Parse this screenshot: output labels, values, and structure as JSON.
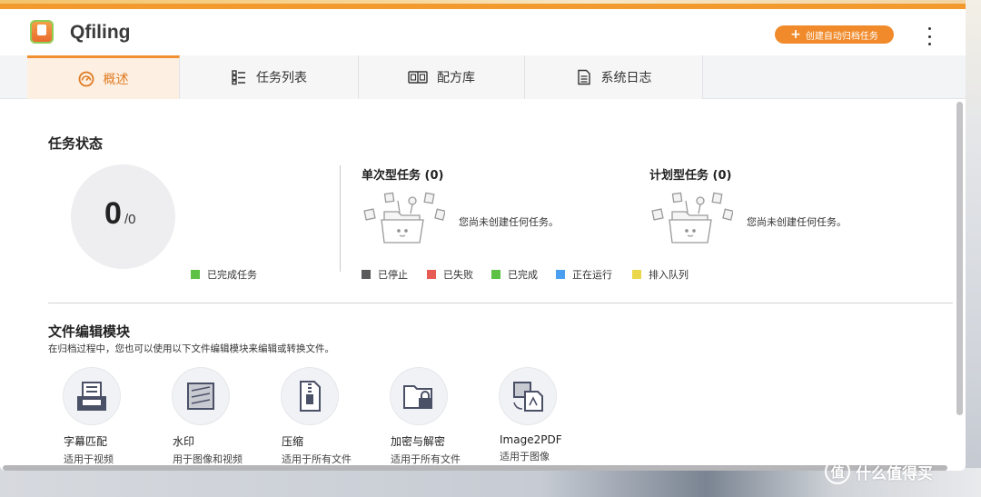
{
  "app": {
    "name": "Qfiling",
    "create_button": "创建自动归档任务",
    "accent_color": "#f08a2a"
  },
  "tabs": [
    {
      "label": "概述",
      "icon": "dashboard-icon",
      "active": true
    },
    {
      "label": "任务列表",
      "icon": "task-list-icon",
      "active": false
    },
    {
      "label": "配方库",
      "icon": "recipe-book-icon",
      "active": false
    },
    {
      "label": "系统日志",
      "icon": "log-icon",
      "active": false
    }
  ],
  "task_status": {
    "title": "任务状态",
    "completed": "0",
    "total": "/0",
    "legend_completed": "已完成任务",
    "single": {
      "title": "单次型任务 (0)",
      "empty_text": "您尚未创建任何任务。"
    },
    "scheduled": {
      "title": "计划型任务 (0)",
      "empty_text": "您尚未创建任何任务。"
    },
    "legend": [
      {
        "label": "已停止",
        "color": "#5a5a5c"
      },
      {
        "label": "已失败",
        "color": "#e85a54"
      },
      {
        "label": "已完成",
        "color": "#5cc145"
      },
      {
        "label": "正在运行",
        "color": "#4a9ff0"
      },
      {
        "label": "排入队列",
        "color": "#ead84a"
      }
    ]
  },
  "modules": {
    "title": "文件编辑模块",
    "description": "在归档过程中，您也可以使用以下文件编辑模块来编辑或转换文件。",
    "items": [
      {
        "name": "字幕匹配",
        "desc": "适用于视频",
        "icon": "subtitle-icon"
      },
      {
        "name": "水印",
        "desc": "用于图像和视频",
        "icon": "watermark-icon"
      },
      {
        "name": "压缩",
        "desc": "适用于所有文件",
        "icon": "compress-icon"
      },
      {
        "name": "加密与解密",
        "desc": "适用于所有文件",
        "icon": "encrypt-icon"
      },
      {
        "name": "Image2PDF",
        "desc": "适用于图像",
        "icon": "image2pdf-icon"
      }
    ]
  },
  "watermark_text": "什么值得买",
  "watermark_glyph": "值"
}
